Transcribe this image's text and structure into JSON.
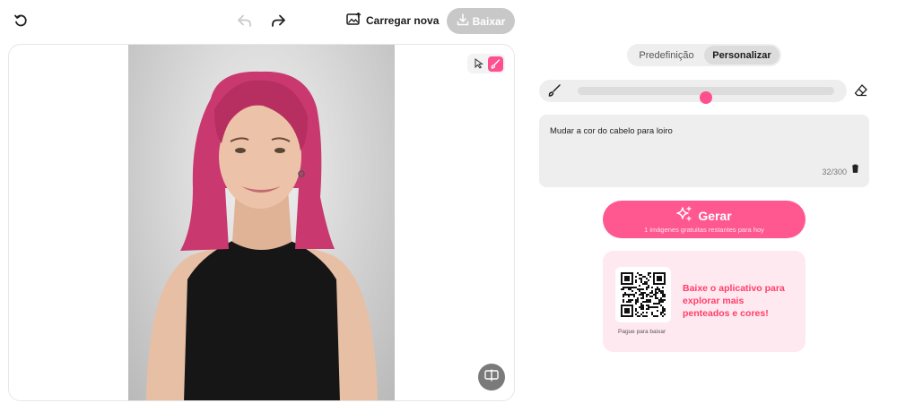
{
  "toolbar": {
    "undo_icon": "undo-icon",
    "back_icon": "back-arrow-icon",
    "forward_icon": "forward-arrow-icon",
    "upload_label": "Carregar nova",
    "download_label": "Baixar"
  },
  "editor": {
    "tools": [
      "cursor-icon",
      "brush-icon"
    ],
    "active_tool": "brush-icon",
    "compare_icon": "compare-icon"
  },
  "mode_tabs": [
    {
      "label": "Predefinição",
      "active": false
    },
    {
      "label": "Personalizar",
      "active": true
    }
  ],
  "brush": {
    "size_fraction": 0.5
  },
  "prompt": {
    "text": "Mudar a cor do cabelo para loiro",
    "counter": "32/300"
  },
  "generate": {
    "label": "Gerar",
    "subtext": "1 imágenes gratuitas restantes para hoy"
  },
  "promo": {
    "text": "Baixe o aplicativo para explorar mais penteados e cores!",
    "qr_caption": "Pague para baixar"
  },
  "colors": {
    "accent": "#ff5890",
    "hair": "#c9386e",
    "disabled": "#c8c8c8"
  }
}
